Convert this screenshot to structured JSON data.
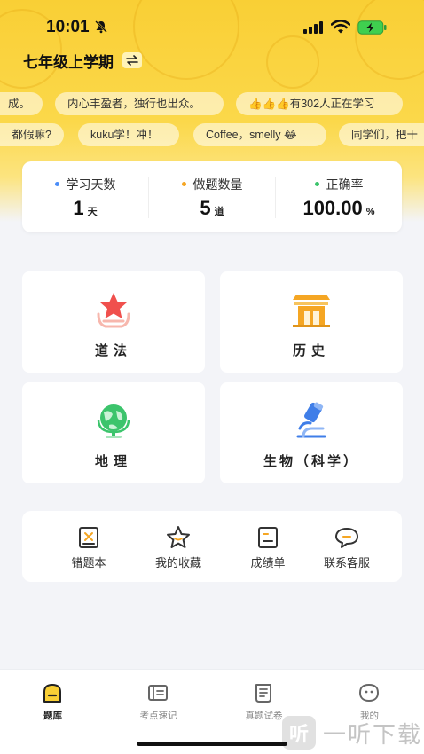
{
  "status_bar": {
    "time": "10:01"
  },
  "header": {
    "grade_title": "七年级上学期"
  },
  "ticker_row1": [
    "成。",
    "内心丰盈者，独行也出众。",
    "👍👍👍有302人正在学习"
  ],
  "ticker_row2": [
    "都假嘛?",
    "kuku学！冲！",
    "Coffee，smelly 😂",
    "同学们，把干"
  ],
  "stats": [
    {
      "label": "学习天数",
      "value": "1",
      "unit": "天",
      "dot_color": "#4b8df8"
    },
    {
      "label": "做题数量",
      "value": "5",
      "unit": "道",
      "dot_color": "#f5a623"
    },
    {
      "label": "正确率",
      "value": "100.00",
      "unit": "%",
      "dot_color": "#3cc46c"
    }
  ],
  "subjects": [
    {
      "label": "道法",
      "icon": "star-badge-icon"
    },
    {
      "label": "历史",
      "icon": "temple-icon"
    },
    {
      "label": "地理",
      "icon": "globe-icon"
    },
    {
      "label": "生物（科学）",
      "icon": "microscope-icon"
    }
  ],
  "tools": [
    {
      "label": "错题本",
      "icon": "wrong-book-icon"
    },
    {
      "label": "我的收藏",
      "icon": "star-outline-icon"
    },
    {
      "label": "成绩单",
      "icon": "report-card-icon"
    },
    {
      "label": "联系客服",
      "icon": "chat-bubble-icon"
    }
  ],
  "nav": [
    {
      "label": "题库",
      "icon": "question-bank-icon",
      "active": true
    },
    {
      "label": "考点速记",
      "icon": "notebook-icon",
      "active": false
    },
    {
      "label": "真题试卷",
      "icon": "exam-paper-icon",
      "active": false
    },
    {
      "label": "我的",
      "icon": "profile-face-icon",
      "active": false
    }
  ],
  "watermark": {
    "logo": "听",
    "text": "一听下载"
  },
  "colors": {
    "brand_yellow": "#f9cf35",
    "accent_red": "#f0504d",
    "bg": "#f3f4f8"
  }
}
